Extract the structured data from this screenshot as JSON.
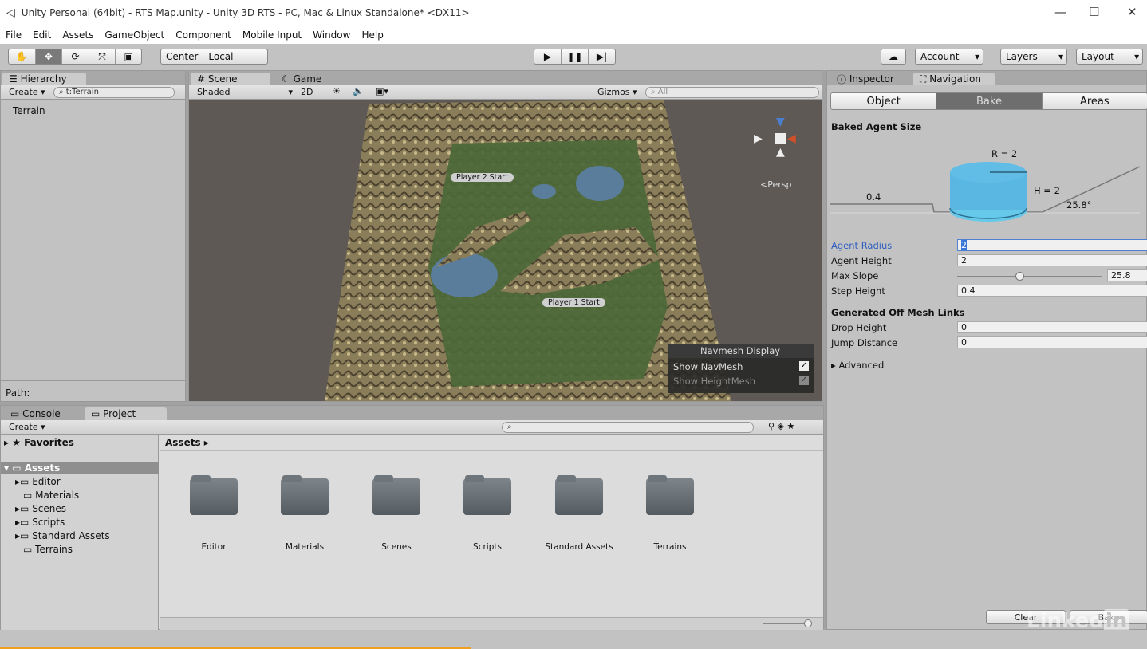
{
  "window": {
    "title": "Unity Personal (64bit) - RTS Map.unity - Unity 3D RTS - PC, Mac & Linux Standalone* <DX11>"
  },
  "menu": [
    "File",
    "Edit",
    "Assets",
    "GameObject",
    "Component",
    "Mobile Input",
    "Window",
    "Help"
  ],
  "toolbar": {
    "pivot": "Center",
    "space": "Local",
    "account": "Account",
    "layers": "Layers",
    "layout": "Layout"
  },
  "hierarchy": {
    "tab": "Hierarchy",
    "create": "Create",
    "search": "t:Terrain",
    "items": [
      "Terrain"
    ],
    "path": "Path:"
  },
  "scene": {
    "tabs": [
      "Scene",
      "Game"
    ],
    "shading": "Shaded",
    "mode2d": "2D",
    "gizmos": "Gizmos",
    "search": "All",
    "persp": "Persp",
    "labels": [
      "Player 2 Start",
      "Player 1 Start"
    ],
    "navmesh": {
      "title": "Navmesh Display",
      "show_navmesh": "Show NavMesh",
      "show_heightmesh": "Show HeightMesh"
    }
  },
  "inspector": {
    "tabs": [
      "Inspector",
      "Navigation"
    ],
    "subtabs": [
      "Object",
      "Bake",
      "Areas"
    ],
    "section": "Baked Agent Size",
    "diagram": {
      "r": "R = 2",
      "h": "H = 2",
      "step": "0.4",
      "slope": "25.8°"
    },
    "fields": [
      {
        "label": "Agent Radius",
        "value": "2"
      },
      {
        "label": "Agent Height",
        "value": "2"
      },
      {
        "label": "Max Slope",
        "value": "25.8"
      },
      {
        "label": "Step Height",
        "value": "0.4"
      }
    ],
    "max_slope_fraction": 0.43,
    "offmesh": "Generated Off Mesh Links",
    "offmesh_fields": [
      {
        "label": "Drop Height",
        "value": "0"
      },
      {
        "label": "Jump Distance",
        "value": "0"
      }
    ],
    "advanced": "Advanced",
    "clear": "Clear",
    "bake": "Bake"
  },
  "bottom": {
    "tabs": [
      "Console",
      "Project"
    ],
    "create": "Create",
    "favorites": "Favorites",
    "assets": "Assets",
    "breadcrumb": "Assets",
    "tree": [
      "Editor",
      "Materials",
      "Scenes",
      "Scripts",
      "Standard Assets",
      "Terrains"
    ],
    "folders": [
      "Editor",
      "Materials",
      "Scenes",
      "Scripts",
      "Standard Assets",
      "Terrains"
    ]
  },
  "watermark": "Linked in"
}
